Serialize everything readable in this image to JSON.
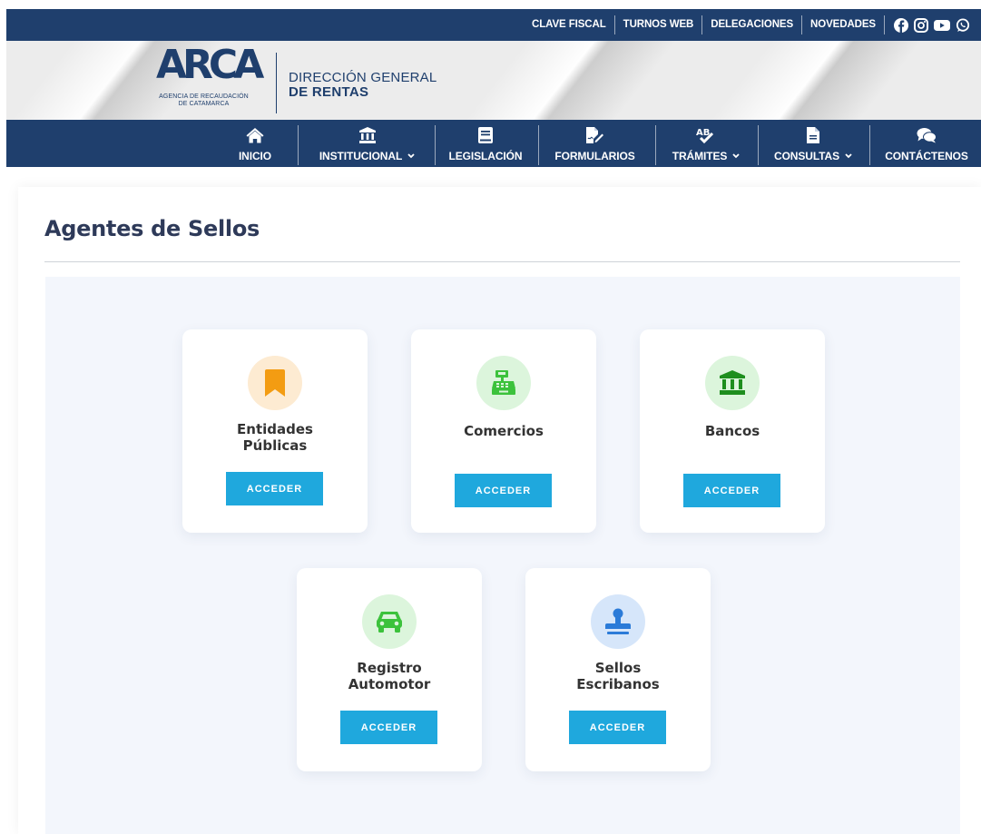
{
  "topbar": {
    "links": [
      "CLAVE FISCAL",
      "TURNOS WEB",
      "DELEGACIONES",
      "NOVEDADES"
    ],
    "social_icons": [
      "facebook-icon",
      "instagram-icon",
      "youtube-icon",
      "whatsapp-icon"
    ]
  },
  "brand": {
    "logo_word": "ARCA",
    "logo_sub_line1": "AGENCIA DE RECAUDACIÓN",
    "logo_sub_line2": "DE CATAMARCA",
    "title_line1": "DIRECCIÓN GENERAL",
    "title_line2": "DE RENTAS"
  },
  "nav": {
    "items": [
      {
        "label": "INICIO",
        "icon": "home-icon"
      },
      {
        "label": "INSTITUCIONAL",
        "icon": "institution-icon"
      },
      {
        "label": "LEGISLACIÓN",
        "icon": "book-icon"
      },
      {
        "label": "FORMULARIOS",
        "icon": "file-signature-icon"
      },
      {
        "label": "TRÁMITES",
        "icon": "spell-check-icon"
      },
      {
        "label": "CONSULTAS",
        "icon": "file-text-icon"
      },
      {
        "label": "CONTÁCTENOS",
        "icon": "comments-icon"
      }
    ]
  },
  "main": {
    "title": "Agentes de Sellos",
    "cards": [
      {
        "title_line1": "Entidades",
        "title_line2": "Públicas",
        "button": "ACCEDER",
        "icon": "bookmark-icon"
      },
      {
        "title_line1": "Comercios",
        "title_line2": "",
        "button": "ACCEDER",
        "icon": "cash-register-icon"
      },
      {
        "title_line1": "Bancos",
        "title_line2": "",
        "button": "ACCEDER",
        "icon": "bank-icon"
      },
      {
        "title_line1": "Registro",
        "title_line2": "Automotor",
        "button": "ACCEDER",
        "icon": "car-icon"
      },
      {
        "title_line1": "Sellos",
        "title_line2": "Escribanos",
        "button": "ACCEDER",
        "icon": "stamp-icon"
      }
    ]
  },
  "colors": {
    "navy": "#1f3f6d",
    "button": "#1fa8dd",
    "panel_bg": "#f3f6fc",
    "orange": "#f39c12",
    "green": "#3cc23c",
    "dark_green": "#1e8e1e",
    "blue": "#2b7bd8"
  }
}
